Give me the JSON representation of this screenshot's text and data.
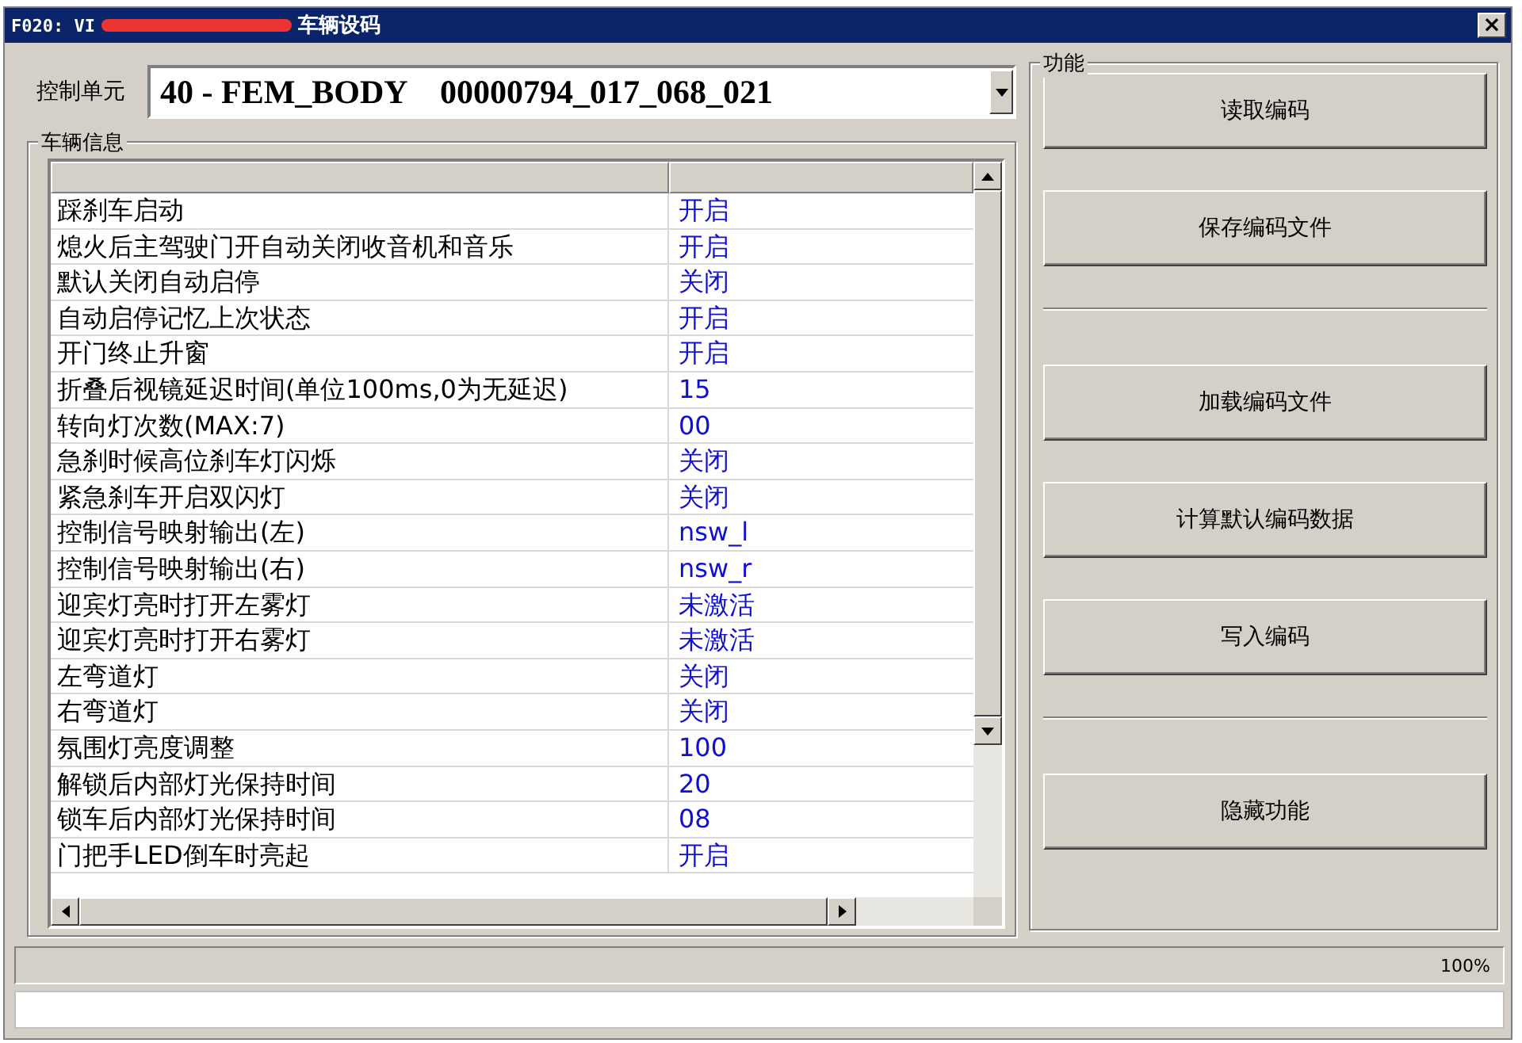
{
  "window": {
    "title_prefix": "F020: VI",
    "title": "车辆设码",
    "close": "×"
  },
  "control_unit": {
    "label": "控制单元",
    "value": "40 - FEM_BODY    00000794_017_068_021"
  },
  "vehicle_info": {
    "title": "车辆信息",
    "rows": [
      {
        "name": "踩刹车启动",
        "value": "开启"
      },
      {
        "name": "熄火后主驾驶门开自动关闭收音机和音乐",
        "value": "开启"
      },
      {
        "name": "默认关闭自动启停",
        "value": "关闭"
      },
      {
        "name": "自动启停记忆上次状态",
        "value": "开启"
      },
      {
        "name": "开门终止升窗",
        "value": "开启"
      },
      {
        "name": "折叠后视镜延迟时间(单位100ms,0为无延迟)",
        "value": "15"
      },
      {
        "name": "转向灯次数(MAX:7)",
        "value": "00"
      },
      {
        "name": "急刹时候高位刹车灯闪烁",
        "value": "关闭"
      },
      {
        "name": "紧急刹车开启双闪灯",
        "value": "关闭"
      },
      {
        "name": "控制信号映射输出(左)",
        "value": "nsw_l"
      },
      {
        "name": "控制信号映射输出(右)",
        "value": "nsw_r"
      },
      {
        "name": "迎宾灯亮时打开左雾灯",
        "value": "未激活"
      },
      {
        "name": "迎宾灯亮时打开右雾灯",
        "value": "未激活"
      },
      {
        "name": "左弯道灯",
        "value": "关闭"
      },
      {
        "name": "右弯道灯",
        "value": "关闭"
      },
      {
        "name": "氛围灯亮度调整",
        "value": "100"
      },
      {
        "name": "解锁后内部灯光保持时间",
        "value": "20"
      },
      {
        "name": "锁车后内部灯光保持时间",
        "value": "08"
      },
      {
        "name": "门把手LED倒车时亮起",
        "value": "开启"
      }
    ]
  },
  "functions": {
    "title": "功能",
    "items": [
      {
        "kind": "button",
        "label": "读取编码"
      },
      {
        "kind": "button",
        "label": "保存编码文件"
      },
      {
        "kind": "separator"
      },
      {
        "kind": "button",
        "label": "加载编码文件"
      },
      {
        "kind": "button",
        "label": "计算默认编码数据"
      },
      {
        "kind": "button",
        "label": "写入编码"
      },
      {
        "kind": "separator"
      },
      {
        "kind": "button",
        "label": "隐藏功能"
      }
    ]
  },
  "status_bar": {
    "zoom": "100%"
  }
}
